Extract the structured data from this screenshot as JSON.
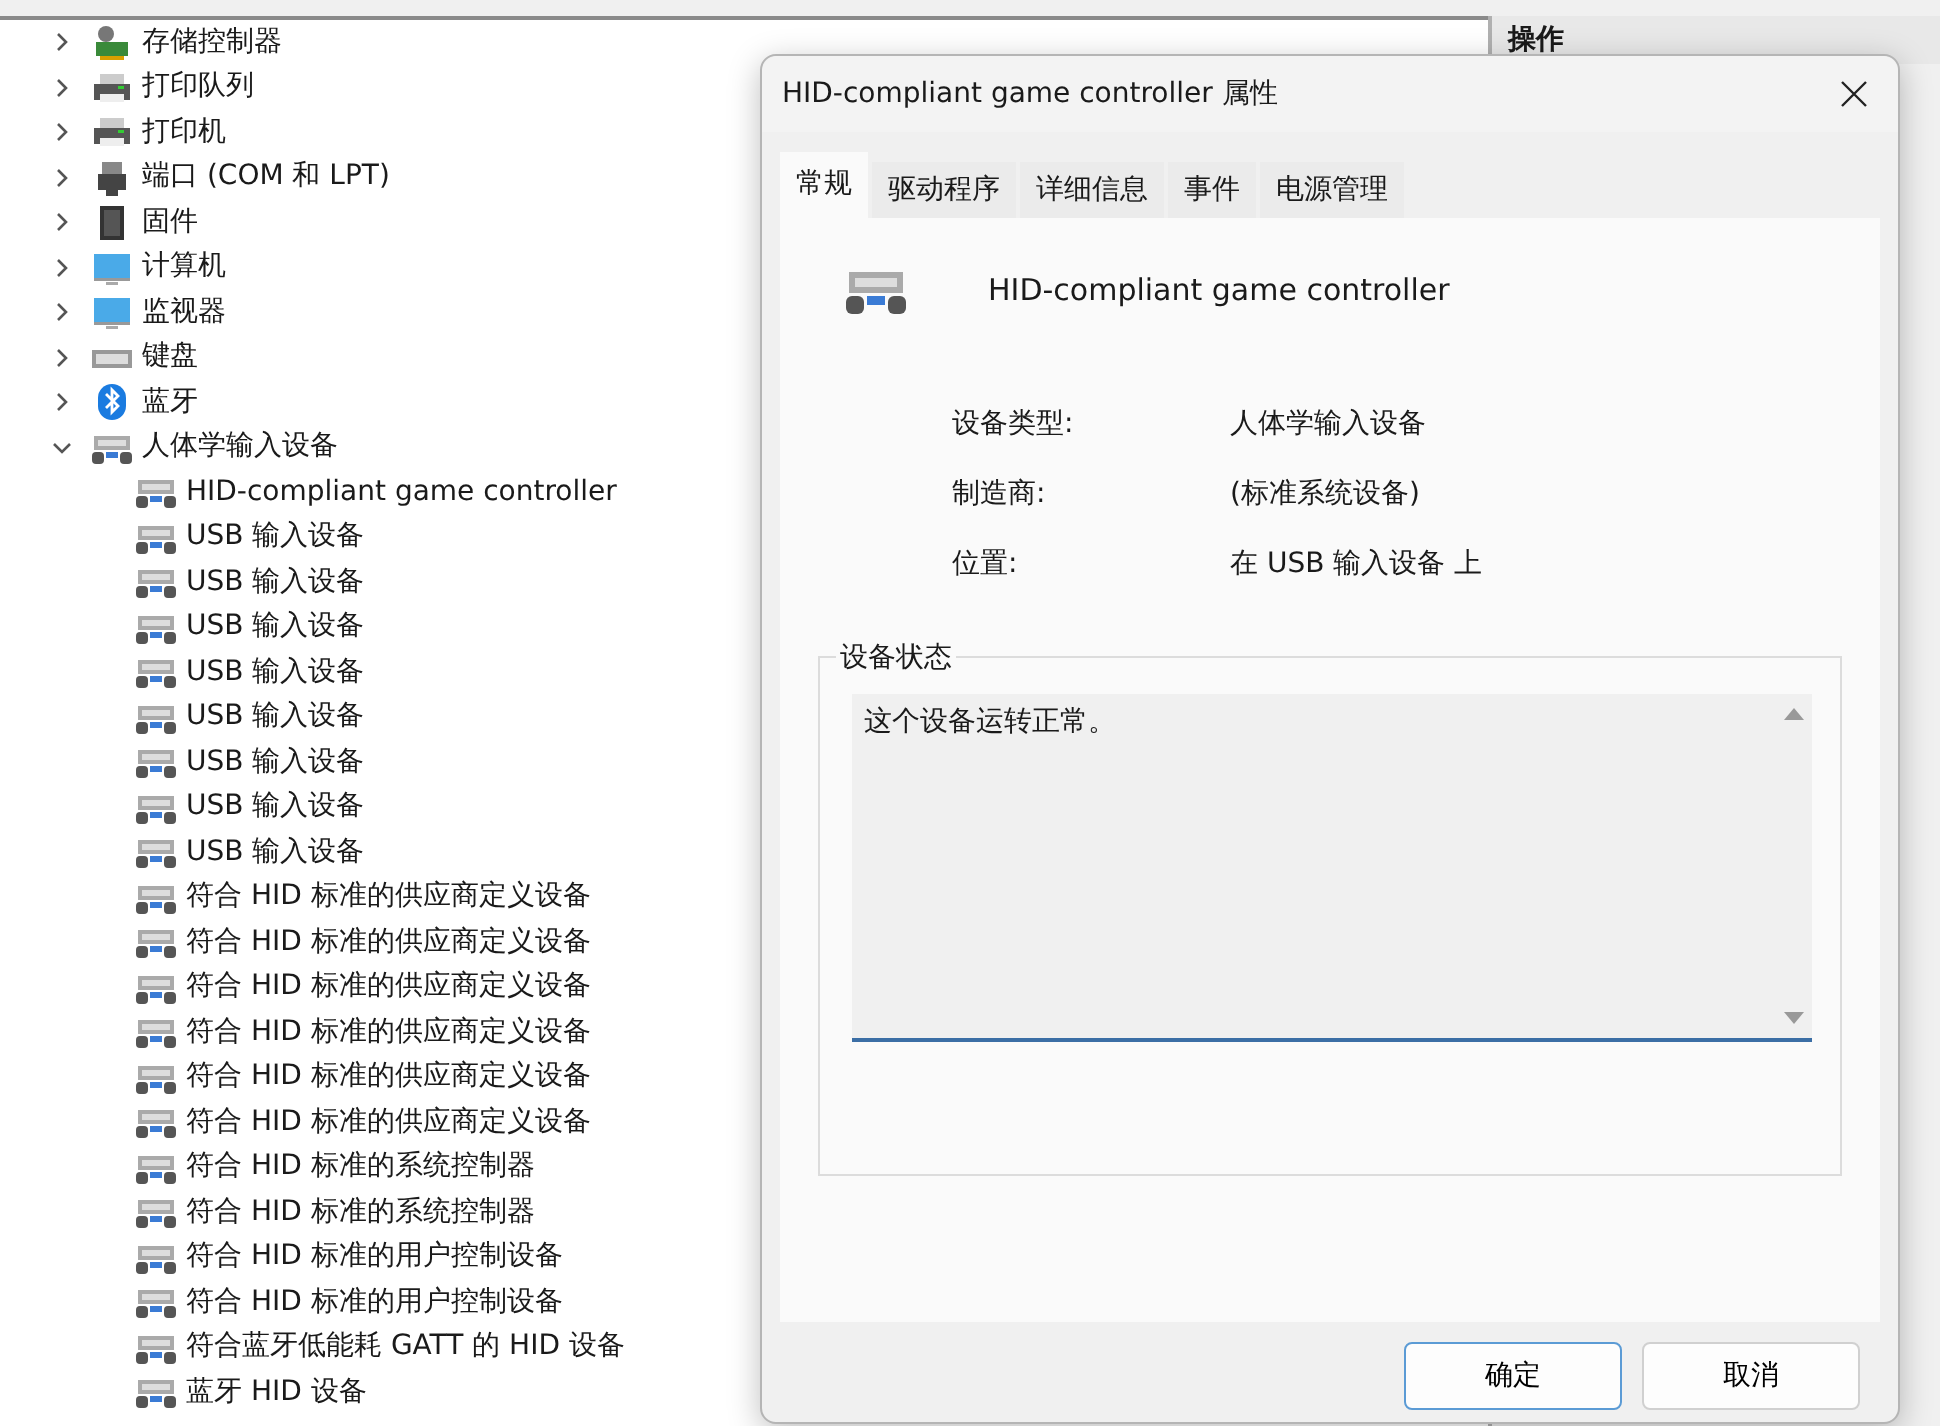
{
  "actions_pane": {
    "title": "操作"
  },
  "tree": [
    {
      "label": "存储控制器",
      "kind": "storage",
      "expanded": false
    },
    {
      "label": "打印队列",
      "kind": "printer",
      "expanded": false
    },
    {
      "label": "打印机",
      "kind": "printer",
      "expanded": false
    },
    {
      "label": "端口 (COM 和 LPT)",
      "kind": "port",
      "expanded": false
    },
    {
      "label": "固件",
      "kind": "chip",
      "expanded": false
    },
    {
      "label": "计算机",
      "kind": "monitor",
      "expanded": false
    },
    {
      "label": "监视器",
      "kind": "monitor",
      "expanded": false
    },
    {
      "label": "键盘",
      "kind": "keyboard",
      "expanded": false
    },
    {
      "label": "蓝牙",
      "kind": "bluetooth",
      "expanded": false
    },
    {
      "label": "人体学输入设备",
      "kind": "hid",
      "expanded": true,
      "children": [
        {
          "label": "HID-compliant game controller",
          "kind": "hid"
        },
        {
          "label": "USB 输入设备",
          "kind": "hid"
        },
        {
          "label": "USB 输入设备",
          "kind": "hid"
        },
        {
          "label": "USB 输入设备",
          "kind": "hid"
        },
        {
          "label": "USB 输入设备",
          "kind": "hid"
        },
        {
          "label": "USB 输入设备",
          "kind": "hid"
        },
        {
          "label": "USB 输入设备",
          "kind": "hid"
        },
        {
          "label": "USB 输入设备",
          "kind": "hid"
        },
        {
          "label": "USB 输入设备",
          "kind": "hid"
        },
        {
          "label": "符合 HID 标准的供应商定义设备",
          "kind": "hid"
        },
        {
          "label": "符合 HID 标准的供应商定义设备",
          "kind": "hid"
        },
        {
          "label": "符合 HID 标准的供应商定义设备",
          "kind": "hid"
        },
        {
          "label": "符合 HID 标准的供应商定义设备",
          "kind": "hid"
        },
        {
          "label": "符合 HID 标准的供应商定义设备",
          "kind": "hid"
        },
        {
          "label": "符合 HID 标准的供应商定义设备",
          "kind": "hid"
        },
        {
          "label": "符合 HID 标准的系统控制器",
          "kind": "hid"
        },
        {
          "label": "符合 HID 标准的系统控制器",
          "kind": "hid"
        },
        {
          "label": "符合 HID 标准的用户控制设备",
          "kind": "hid"
        },
        {
          "label": "符合 HID 标准的用户控制设备",
          "kind": "hid"
        },
        {
          "label": "符合蓝牙低能耗 GATT 的 HID 设备",
          "kind": "hid"
        },
        {
          "label": "蓝牙 HID 设备",
          "kind": "hid"
        }
      ]
    }
  ],
  "dialog": {
    "title": "HID-compliant game controller 属性",
    "tabs": [
      {
        "label": "常规",
        "selected": true
      },
      {
        "label": "驱动程序",
        "selected": false
      },
      {
        "label": "详细信息",
        "selected": false
      },
      {
        "label": "事件",
        "selected": false
      },
      {
        "label": "电源管理",
        "selected": false
      }
    ],
    "device_name": "HID-compliant game controller",
    "properties": [
      {
        "label": "设备类型:",
        "value": "人体学输入设备"
      },
      {
        "label": "制造商:",
        "value": "(标准系统设备)"
      },
      {
        "label": "位置:",
        "value": "在 USB 输入设备 上"
      }
    ],
    "status": {
      "title": "设备状态",
      "text": "这个设备运转正常。"
    },
    "buttons": [
      "确定",
      "取消"
    ]
  }
}
